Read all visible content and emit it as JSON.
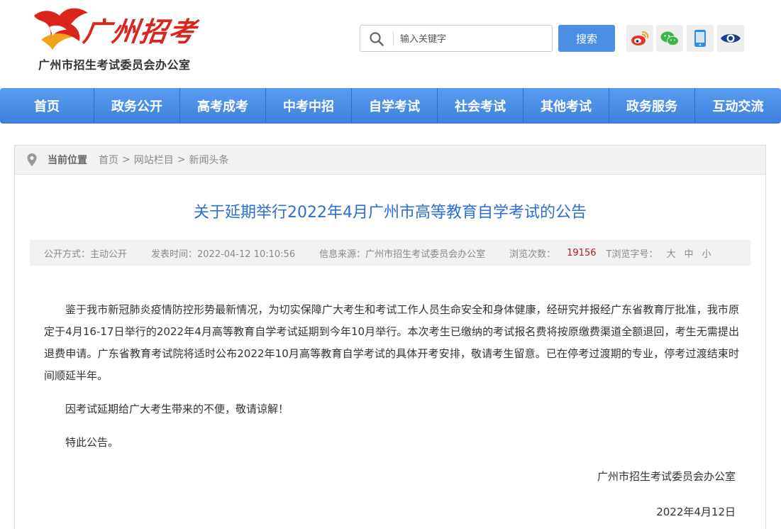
{
  "header": {
    "logo_title": "广州招考",
    "logo_subtitle": "广州市招生考试委员会办公室",
    "search_placeholder": "输入关键字",
    "search_button": "搜索",
    "social_icons": [
      "weibo-icon",
      "wechat-icon",
      "mobile-icon",
      "eye-icon"
    ]
  },
  "nav": {
    "items": [
      "首页",
      "政务公开",
      "高考成考",
      "中考中招",
      "自学考试",
      "社会考试",
      "其他考试",
      "政务服务",
      "互动交流"
    ]
  },
  "breadcrumb": {
    "label": "当前位置",
    "items": [
      "首页",
      "网站栏目",
      "新闻头条"
    ],
    "separator": ">"
  },
  "article": {
    "title": "关于延期举行2022年4月广州市高等教育自学考试的公告",
    "meta": {
      "open_mode": "公开方式：主动公开",
      "publish_time": "发表时间：2022-04-12 10:10:56",
      "source": "信息来源：广州市招生考试委员会办公室",
      "views_label": "浏览次数：",
      "views": "19156",
      "font_size_label": "T浏览字号：",
      "font_sizes": [
        "大",
        "中",
        "小"
      ]
    },
    "paragraphs": [
      "鉴于我市新冠肺炎疫情防控形势最新情况，为切实保障广大考生和考试工作人员生命安全和身体健康，经研究并报经广东省教育厅批准，我市原定于4月16-17日举行的2022年4月高等教育自学考试延期到今年10月举行。本次考生已缴纳的考试报名费将按原缴费渠道全额退回，考生无需提出退费申请。广东省教育考试院将适时公布2022年10月高等教育自学考试的具体开考安排，敬请考生留意。已在停考过渡期的专业，停考过渡结束时间顺延半年。",
      "因考试延期给广大考生带来的不便，敬请谅解！",
      "特此公告。"
    ],
    "signature": "广州市招生考试委员会办公室",
    "date": "2022年4月12日"
  },
  "colors": {
    "nav_blue": "#4a8ae6",
    "title_blue": "#2a6fd6",
    "logo_red": "#d9251d",
    "views_red": "#c0152c"
  }
}
